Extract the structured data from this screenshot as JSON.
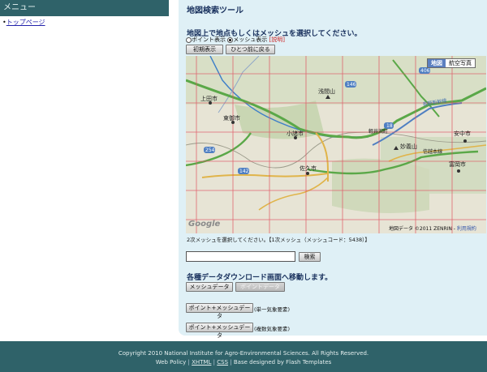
{
  "sidebar": {
    "heading": "メニュー",
    "bullet": "•",
    "top_link": "トップページ"
  },
  "main": {
    "title": "地図検索ツール",
    "instruction": "地図上で地点もしくはメッシュを選択してください。",
    "mode": {
      "point_label": "ポイント表示",
      "mesh_label": "メッシュ表示",
      "help_label": "[説明]",
      "selected": "mesh"
    },
    "buttons": {
      "initial_view": "初期表示",
      "back": "ひとつ前に戻る",
      "search": "検索"
    },
    "map": {
      "type_map": "地図",
      "type_aerial": "航空写真",
      "credit": "地図データ ©2011 ZENRIN - ",
      "terms": "利用規約",
      "google": "Google",
      "places": {
        "ueda": "上田市",
        "tomi": "東御市",
        "komoro": "小諸市",
        "saku": "佐久市",
        "asama": "浅間山",
        "myogi": "妙義山",
        "annaka": "安中市",
        "tomioka": "富岡市",
        "shinetsu": "信越本線",
        "nagano_shinkansen": "長野新幹線",
        "karuizawa": "軽井沢町"
      },
      "route_labels": {
        "r18": "18",
        "r146": "146",
        "r406": "406",
        "r254": "254",
        "r142": "142"
      }
    },
    "mesh_status": "2次メッシュを選択してください。【1次メッシュ（メッシュコード：5438）】",
    "search_input": {
      "value": "",
      "placeholder": ""
    },
    "download": {
      "heading": "各種データダウンロード画面へ移動します。",
      "mesh_data": "メッシュデータ",
      "point_data": "ポイントデータ",
      "point_mesh_single": "ポイント+メッシュデータ",
      "single_note": "(単一気象要素)",
      "point_mesh_multi": "ポイント+メッシュデータ",
      "multi_note": "(複数気象要素)"
    }
  },
  "footer": {
    "copyright": "Copyright 2010 National Institute for Agro-Environmental Sciences. All Rights Reserved.",
    "web_policy": "Web Policy",
    "xhtml": "XHTML",
    "css": "CSS",
    "designed": "Base designed by Flash Templates",
    "sep": "|"
  },
  "colors": {
    "header_teal": "#2f6269",
    "panel_bg": "#dff0f6",
    "heading_navy": "#172f5c",
    "mesh_red": "#e05060",
    "road_green": "#5aa848",
    "rail_blue": "#4f7fc2"
  }
}
